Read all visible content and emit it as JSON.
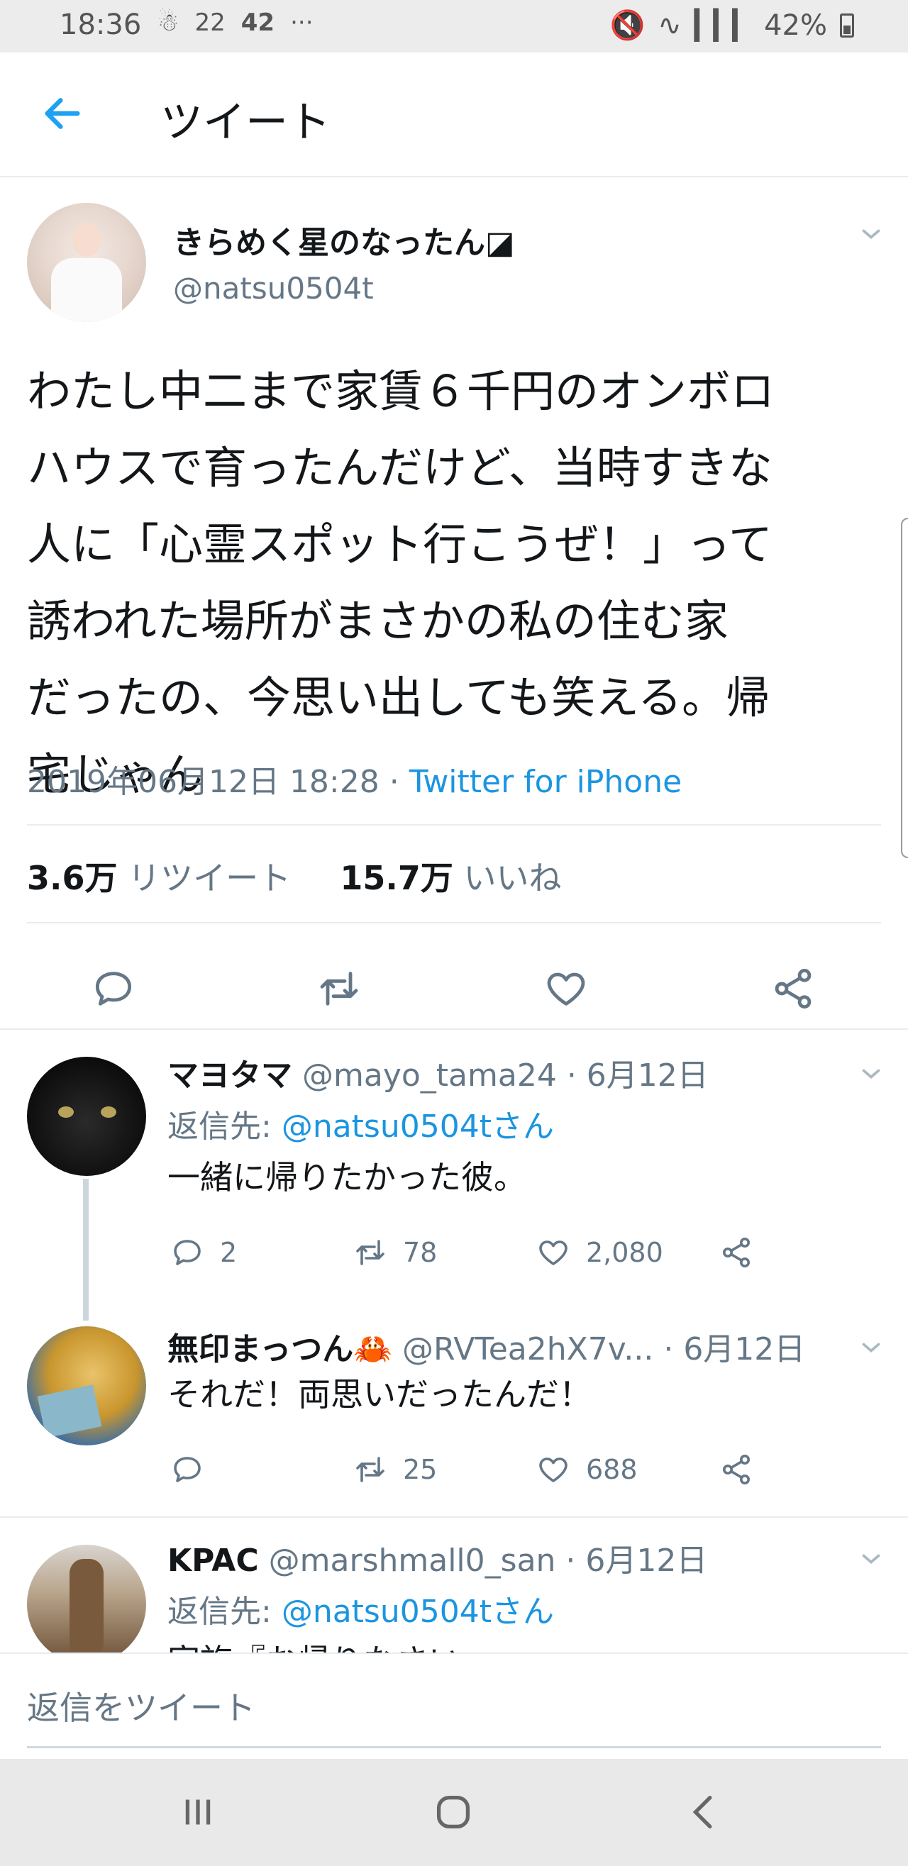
{
  "status_bar": {
    "time": "18:36",
    "left_icons_text": "22",
    "left_icons_text2": "42",
    "more": "···",
    "battery": "42%"
  },
  "header": {
    "title": "ツイート"
  },
  "tweet": {
    "display_name": "きらめく星のなったん◪",
    "handle": "@natsu0504t",
    "text_lines": [
      "わたし中二まで家賃６千円のオンボロ",
      "ハウスで育ったんだけど、当時すきな",
      "人に「心霊スポット行こうぜ！」って",
      "誘われた場所がまさかの私の住む家",
      "だったの、今思い出しても笑える。帰",
      "宅じゃん"
    ],
    "datetime": "2019年06月12日 18:28",
    "separator": " · ",
    "source": "Twitter for iPhone",
    "retweet_count": "3.6万",
    "retweet_label": "リツイート",
    "like_count": "15.7万",
    "like_label": "いいね"
  },
  "replies": [
    {
      "name": "マヨタマ",
      "handle": "@mayo_tama24",
      "date": "· 6月12日",
      "reply_to_prefix": "返信先: ",
      "reply_to": "@natsu0504tさん",
      "text": "一緒に帰りたかった彼。",
      "reply_count": "2",
      "retweet_count": "78",
      "like_count": "2,080"
    },
    {
      "name": "無印まっつん🦀",
      "handle": "@RVTea2hX7v...",
      "date": "· 6月12日",
      "text": "それだ！両思いだったんだ！",
      "reply_count": "",
      "retweet_count": "25",
      "like_count": "688"
    },
    {
      "name": "KPAC",
      "handle": "@marshmall0_san",
      "date": "· 6月12日",
      "reply_to_prefix": "返信先: ",
      "reply_to": "@natsu0504tさん",
      "text": "家族『お帰りなさい』"
    }
  ],
  "composer": {
    "placeholder": "返信をツイート"
  },
  "colors": {
    "accent": "#1da1f2",
    "link": "#1b95e0",
    "muted": "#657786",
    "divider": "#e6ecf0"
  }
}
